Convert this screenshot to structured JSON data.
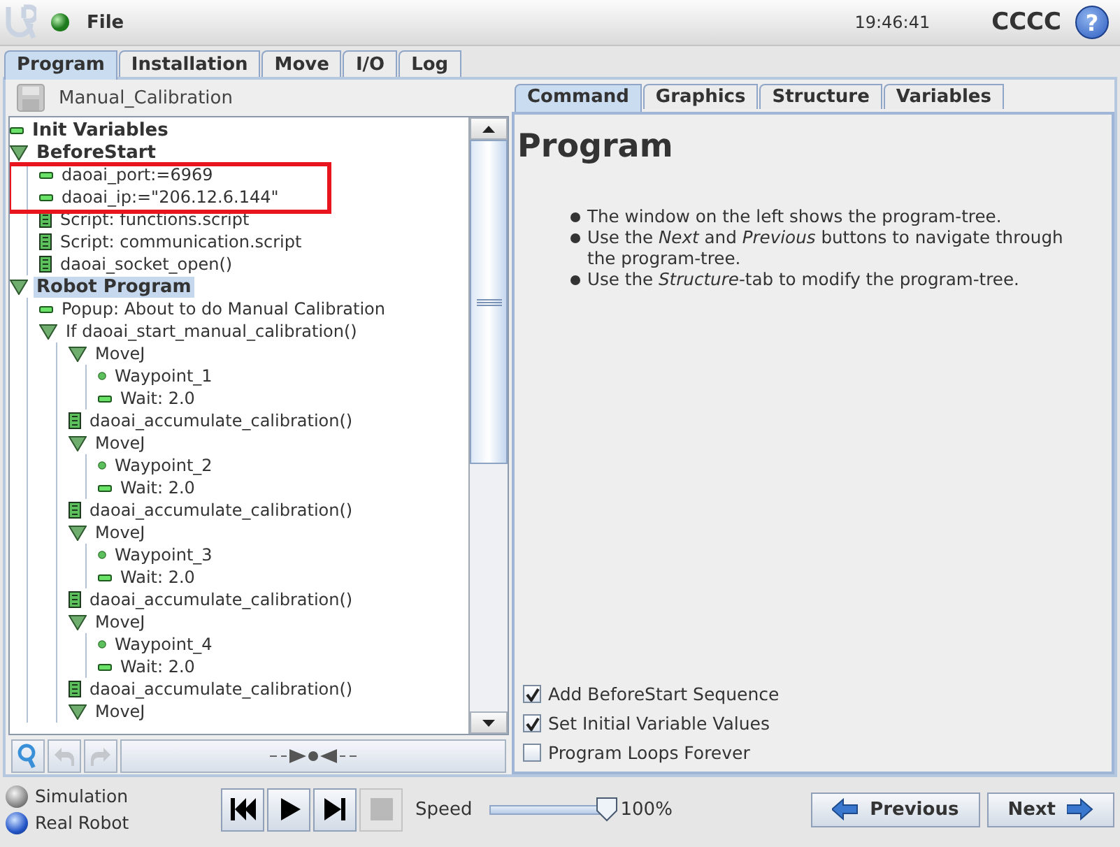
{
  "top_bar": {
    "menu": "File",
    "time": "19:46:41",
    "robot_name": "CCCC",
    "help": "?"
  },
  "main_tabs": [
    {
      "label": "Program",
      "selected": true
    },
    {
      "label": "Installation",
      "selected": false
    },
    {
      "label": "Move",
      "selected": false
    },
    {
      "label": "I/O",
      "selected": false
    },
    {
      "label": "Log",
      "selected": false
    }
  ],
  "program_name": "Manual_Calibration",
  "tree": {
    "items": [
      {
        "kind": "bar",
        "label": "Init Variables",
        "bold": true,
        "selected": false
      },
      {
        "kind": "folder",
        "label": "BeforeStart",
        "bold": true,
        "selected": false,
        "children": [
          {
            "kind": "bar",
            "label": "daoai_port:=6969",
            "selected": false
          },
          {
            "kind": "bar",
            "label": "daoai_ip:=\"206.12.6.144\"",
            "selected": false
          },
          {
            "kind": "script",
            "label": "Script: functions.script",
            "selected": false
          },
          {
            "kind": "script",
            "label": "Script: communication.script",
            "selected": false
          },
          {
            "kind": "script",
            "label": "daoai_socket_open()",
            "selected": false
          }
        ]
      },
      {
        "kind": "folder",
        "label": "Robot Program",
        "bold": true,
        "selected": true,
        "children": [
          {
            "kind": "bar",
            "label": "Popup: About to do Manual Calibration",
            "selected": false
          },
          {
            "kind": "folder",
            "label": "If daoai_start_manual_calibration()",
            "selected": false,
            "children": [
              {
                "kind": "folder",
                "label": "MoveJ",
                "selected": false,
                "children": [
                  {
                    "kind": "point",
                    "label": "Waypoint_1",
                    "selected": false
                  },
                  {
                    "kind": "bar",
                    "label": "Wait: 2.0",
                    "selected": false
                  }
                ]
              },
              {
                "kind": "script",
                "label": "daoai_accumulate_calibration()",
                "selected": false
              },
              {
                "kind": "folder",
                "label": "MoveJ",
                "selected": false,
                "children": [
                  {
                    "kind": "point",
                    "label": "Waypoint_2",
                    "selected": false
                  },
                  {
                    "kind": "bar",
                    "label": "Wait: 2.0",
                    "selected": false
                  }
                ]
              },
              {
                "kind": "script",
                "label": "daoai_accumulate_calibration()",
                "selected": false
              },
              {
                "kind": "folder",
                "label": "MoveJ",
                "selected": false,
                "children": [
                  {
                    "kind": "point",
                    "label": "Waypoint_3",
                    "selected": false
                  },
                  {
                    "kind": "bar",
                    "label": "Wait: 2.0",
                    "selected": false
                  }
                ]
              },
              {
                "kind": "script",
                "label": "daoai_accumulate_calibration()",
                "selected": false
              },
              {
                "kind": "folder",
                "label": "MoveJ",
                "selected": false,
                "children": [
                  {
                    "kind": "point",
                    "label": "Waypoint_4",
                    "selected": false
                  },
                  {
                    "kind": "bar",
                    "label": "Wait: 2.0",
                    "selected": false
                  }
                ]
              },
              {
                "kind": "script",
                "label": "daoai_accumulate_calibration()",
                "selected": false
              },
              {
                "kind": "folder",
                "label": "MoveJ",
                "selected": false
              }
            ]
          }
        ]
      }
    ],
    "annotation": {
      "kind": "red-box"
    }
  },
  "sub_tabs": [
    {
      "label": "Command",
      "selected": true
    },
    {
      "label": "Graphics",
      "selected": false
    },
    {
      "label": "Structure",
      "selected": false
    },
    {
      "label": "Variables",
      "selected": false
    }
  ],
  "command": {
    "title": "Program",
    "bullets": [
      "The window on the left shows the program-tree.",
      "Use the *Next* and *Previous* buttons to navigate through the program-tree.",
      "Use the *Structure*-tab to modify the program-tree."
    ],
    "options": [
      {
        "label": "Add BeforeStart Sequence",
        "checked": true
      },
      {
        "label": "Set Initial Variable Values",
        "checked": true
      },
      {
        "label": "Program Loops Forever",
        "checked": false
      }
    ]
  },
  "modes": [
    {
      "label": "Simulation",
      "selected": false
    },
    {
      "label": "Real Robot",
      "selected": true
    }
  ],
  "transport": [
    {
      "kind": "rewind",
      "disabled": false
    },
    {
      "kind": "play",
      "disabled": false
    },
    {
      "kind": "step",
      "disabled": false
    },
    {
      "kind": "stop",
      "disabled": true
    }
  ],
  "speed": {
    "label": "Speed",
    "level": 1.0,
    "reading": "100%"
  },
  "nav": [
    {
      "kind": "previous",
      "label": "Previous"
    },
    {
      "kind": "next",
      "label": "Next"
    }
  ]
}
